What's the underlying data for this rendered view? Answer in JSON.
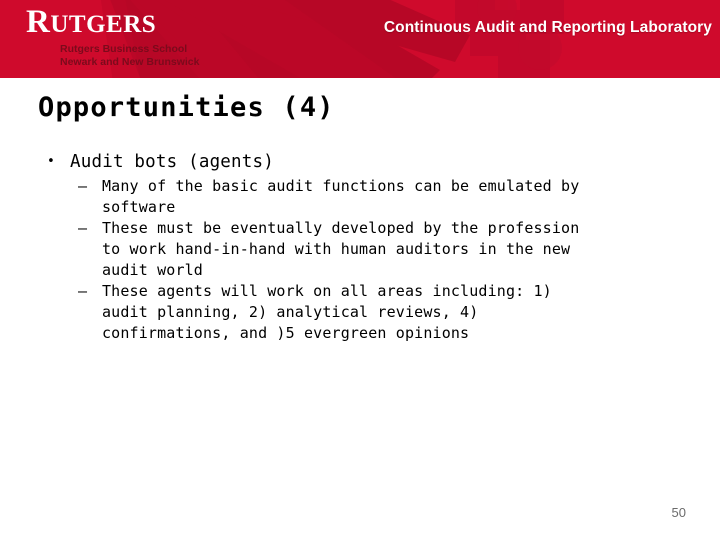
{
  "header": {
    "title": "Continuous Audit and Reporting Laboratory",
    "background_color": "#cf0a2c",
    "logo": {
      "wordmark_first_letter": "R",
      "wordmark_rest": "UTGERS",
      "subtitle_line1": "Rutgers Business School",
      "subtitle_line2": "Newark and New Brunswick",
      "subtitle_color": "#7c0a1c"
    }
  },
  "slide": {
    "title": "Opportunities (4)",
    "page_number": "50",
    "bullets": [
      {
        "marker": "•",
        "text": "Audit bots (agents)",
        "children": [
          {
            "marker": "–",
            "lines": [
              "Many of the basic audit functions can be emulated by",
              "software"
            ]
          },
          {
            "marker": "–",
            "lines": [
              "These must be eventually developed by the profession",
              "to work hand-in-hand with human auditors in the new",
              "audit world"
            ]
          },
          {
            "marker": "–",
            "lines": [
              "These agents will work on all areas including: 1)",
              "audit planning, 2) analytical reviews, 4)",
              "confirmations, and )5 evergreen opinions"
            ]
          }
        ]
      }
    ]
  }
}
